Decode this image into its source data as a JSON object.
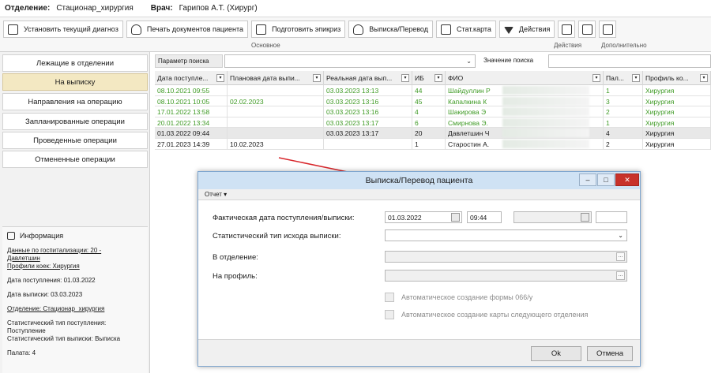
{
  "info_bar": {
    "dept_label": "Отделение:",
    "dept_value": "Стационар_хирургия",
    "doctor_label": "Врач:",
    "doctor_value": "Гарипов А.Т. (Хирург)"
  },
  "toolbar": {
    "set_diagnosis": "Установить текущий диагноз",
    "print_docs": "Печать документов пациента",
    "prepare_epicrisis": "Подготовить эпикриз",
    "discharge_transfer": "Выписка/Перевод",
    "stat_card": "Стат.карта",
    "actions": "Действия",
    "group_main": "Основное",
    "group_actions": "Действия",
    "group_extra": "Дополнительно"
  },
  "sidebar": {
    "items": [
      {
        "label": "Лежащие в отделении",
        "active": false
      },
      {
        "label": "На выписку",
        "active": true
      },
      {
        "label": "Направления на операцию",
        "active": false
      },
      {
        "label": "Запланированные операции",
        "active": false
      },
      {
        "label": "Проведенные операции",
        "active": false
      },
      {
        "label": "Отмененные операции",
        "active": false
      }
    ],
    "info": {
      "title": "Информация",
      "hosp_data": "Данные по госпитализации: 20 -",
      "hosp_name": "Давлетшин",
      "bed_profiles": "Профили коек: Хирургия",
      "admit_date": "Дата поступления: 01.03.2022",
      "discharge_date": "Дата выписки: 03.03.2023",
      "department": "Отделение: Стационар_хирургия",
      "stat_admit_type_label": "Статистический тип поступления:",
      "stat_admit_type_value": "Поступление",
      "stat_discharge_type": "Статистический тип выписки: Выписка",
      "ward": "Палата: 4"
    }
  },
  "search": {
    "param_label": "Параметр поиска",
    "value_label": "Значение поиска"
  },
  "grid": {
    "columns": [
      "Дата поступле...",
      "Плановая дата выпи...",
      "Реальная дата вып...",
      "ИБ",
      "ФИО",
      "Пал...",
      "Профиль ко..."
    ],
    "rows": [
      {
        "admit": "08.10.2021 09:55",
        "planned": "",
        "real": "03.03.2023 13:13",
        "ib": "44",
        "name": "Шайдуллин Р",
        "ward": "1",
        "profile": "Хирургия",
        "green": true,
        "sel": false
      },
      {
        "admit": "08.10.2021 10:05",
        "planned": "02.02.2023",
        "real": "03.03.2023 13:16",
        "ib": "45",
        "name": "Капалкина К",
        "ward": "3",
        "profile": "Хирургия",
        "green": true,
        "sel": false
      },
      {
        "admit": "17.01.2022 13:58",
        "planned": "",
        "real": "03.03.2023 13:16",
        "ib": "4",
        "name": "Шакирова Э",
        "ward": "2",
        "profile": "Хирургия",
        "green": true,
        "sel": false
      },
      {
        "admit": "20.01.2022 13:34",
        "planned": "",
        "real": "03.03.2023 13:17",
        "ib": "6",
        "name": "Смирнова Э.",
        "ward": "1",
        "profile": "Хирургия",
        "green": true,
        "sel": false
      },
      {
        "admit": "01.03.2022 09:44",
        "planned": "",
        "real": "03.03.2023 13:17",
        "ib": "20",
        "name": "Давлетшин Ч",
        "ward": "4",
        "profile": "Хирургия",
        "green": false,
        "sel": true
      },
      {
        "admit": "27.01.2023 14:39",
        "planned": "10.02.2023",
        "real": "",
        "ib": "1",
        "name": "Старостин А.",
        "ward": "2",
        "profile": "Хирургия",
        "green": false,
        "sel": false
      }
    ]
  },
  "dialog": {
    "title": "Выписка/Перевод пациента",
    "menu_report": "Отчет ▾",
    "fact_date_label": "Фактическая дата поступления/выписки:",
    "admit_date": "01.03.2022",
    "admit_time": "09:44",
    "stat_type_label": "Статистический тип исхода выписки:",
    "to_dept_label": "В отделение:",
    "to_profile_label": "На профиль:",
    "auto_form_066": "Автоматическое создание формы 066/у",
    "auto_next_card": "Автоматическое создание карты следующего отделения",
    "ok": "Ok",
    "cancel": "Отмена"
  },
  "colors": {
    "green_text": "#3e9a24",
    "active_nav": "#f3e8c2",
    "dialog_title_bg": "#cfe2f4",
    "close_button": "#c8322b",
    "arrow": "#d8262b"
  }
}
